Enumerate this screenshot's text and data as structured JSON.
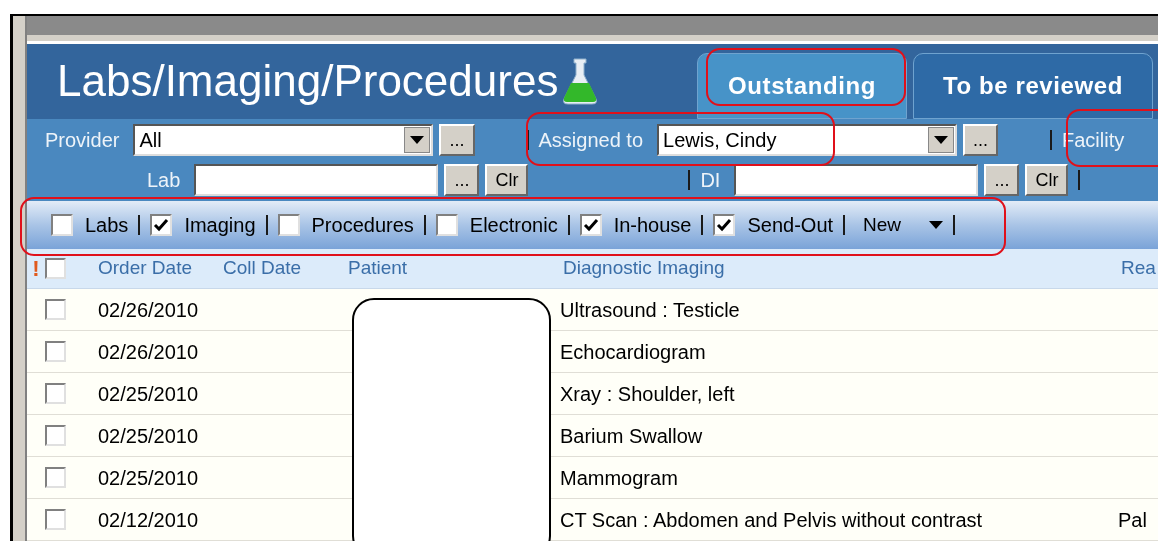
{
  "window": {
    "title": "Labs/Imaging/Procedures"
  },
  "tabs": [
    {
      "label": "Outstanding",
      "selected": true
    },
    {
      "label": "To be reviewed",
      "selected": false
    }
  ],
  "filter_rows": [
    [
      {
        "kind": "dropdown",
        "label": "Provider",
        "value": "All",
        "buttons": [
          "..."
        ]
      },
      {
        "kind": "dropdown",
        "label": "Assigned to",
        "value": "Lewis, Cindy",
        "buttons": [
          "..."
        ]
      },
      {
        "kind": "label",
        "label": "Facility"
      }
    ],
    [
      {
        "kind": "text",
        "label": "Lab",
        "buttons": [
          "...",
          "Clr"
        ]
      },
      {
        "kind": "text",
        "label": "DI",
        "buttons": [
          "...",
          "Clr"
        ]
      }
    ]
  ],
  "toolbar": {
    "checkboxes": [
      {
        "label": "Labs",
        "checked": false
      },
      {
        "label": "Imaging",
        "checked": true
      },
      {
        "label": "Procedures",
        "checked": false
      },
      {
        "label": "Electronic",
        "checked": false
      },
      {
        "label": "In-house",
        "checked": true
      },
      {
        "label": "Send-Out",
        "checked": true
      }
    ],
    "menu_button": "New"
  },
  "table": {
    "priority_mark": "!",
    "select_all_checked": false,
    "columns": [
      "Order Date",
      "Coll Date",
      "Patient",
      "Diagnostic Imaging",
      "Rea"
    ],
    "rows": [
      {
        "checked": false,
        "order_date": "02/26/2010",
        "diagnostic_imaging": "Ultrasound : Testicle"
      },
      {
        "checked": false,
        "order_date": "02/26/2010",
        "diagnostic_imaging": "Echocardiogram"
      },
      {
        "checked": false,
        "order_date": "02/25/2010",
        "diagnostic_imaging": "Xray : Shoulder, left"
      },
      {
        "checked": false,
        "order_date": "02/25/2010",
        "diagnostic_imaging": "Barium Swallow"
      },
      {
        "checked": false,
        "order_date": "02/25/2010",
        "diagnostic_imaging": "Mammogram"
      },
      {
        "checked": false,
        "order_date": "02/12/2010",
        "diagnostic_imaging": "CT Scan : Abdomen and Pelvis without contrast",
        "column_5": "Pal"
      }
    ]
  }
}
